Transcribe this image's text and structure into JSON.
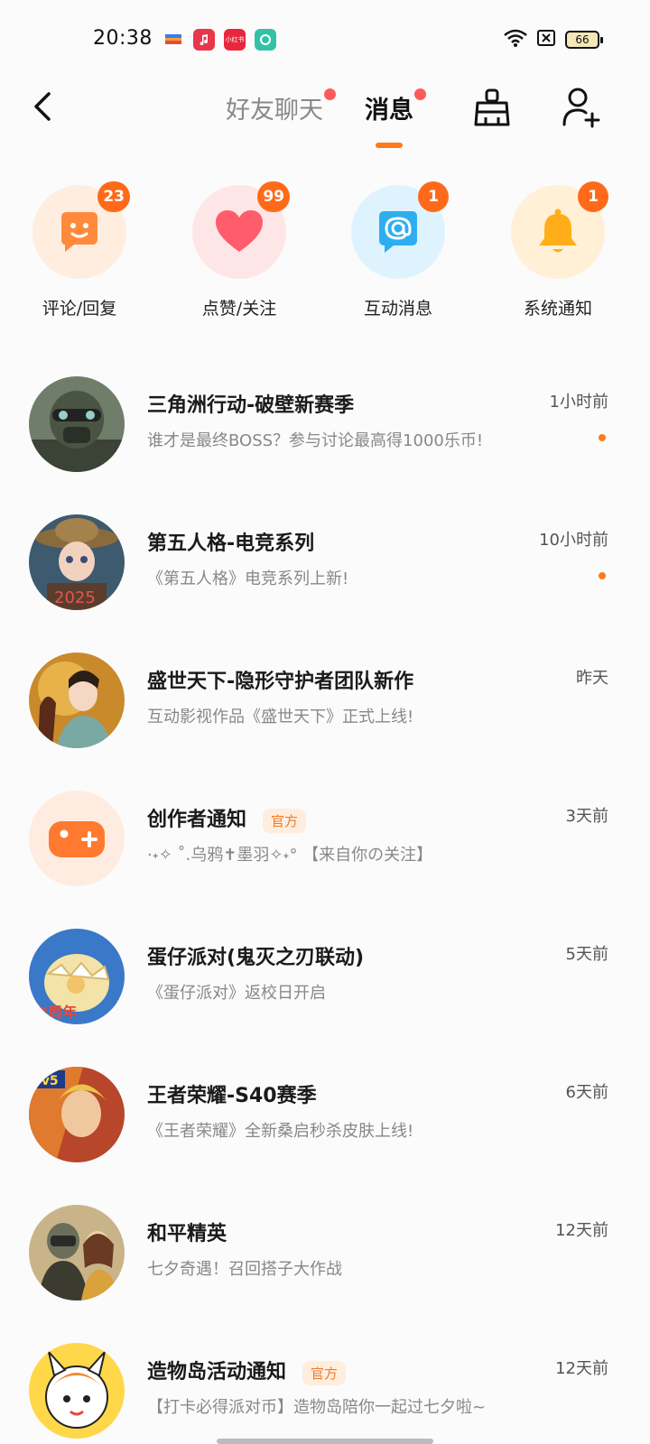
{
  "status_bar": {
    "time": "20:38",
    "apps": [
      "wallet-icon",
      "music-icon",
      "xiaohongshu-icon",
      "soul-icon"
    ],
    "xhs_label": "小红书",
    "battery": "66"
  },
  "nav": {
    "tabs": [
      {
        "label": "好友聊天",
        "active": false,
        "has_dot": true
      },
      {
        "label": "消息",
        "active": true,
        "has_dot": true
      }
    ],
    "accent_color": "#ff7a1a"
  },
  "categories": [
    {
      "label": "评论/回复",
      "badge": "23",
      "icon": "smile-chat-icon",
      "bg": "#ffeee0",
      "fg": "#ff8a3d"
    },
    {
      "label": "点赞/关注",
      "badge": "99",
      "icon": "heart-icon",
      "bg": "#ffe6e6",
      "fg": "#ff5c6c"
    },
    {
      "label": "互动消息",
      "badge": "1",
      "icon": "at-sign-icon",
      "bg": "#dff3ff",
      "fg": "#2eaef0"
    },
    {
      "label": "系统通知",
      "badge": "1",
      "icon": "bell-icon",
      "bg": "#fff0d6",
      "fg": "#ffae1a"
    }
  ],
  "messages": [
    {
      "title": "三角洲行动-破壁新赛季",
      "subtitle": "谁才是最终BOSS？参与讨论最高得1000乐币!",
      "time": "1小时前",
      "unread": true,
      "official": false
    },
    {
      "title": "第五人格-电竞系列",
      "subtitle": "《第五人格》电竞系列上新!",
      "time": "10小时前",
      "unread": true,
      "official": false
    },
    {
      "title": "盛世天下-隐形守护者团队新作",
      "subtitle": "互动影视作品《盛世天下》正式上线!",
      "time": "昨天",
      "unread": false,
      "official": false
    },
    {
      "title": "创作者通知",
      "subtitle": "·˖✧ ˚.乌鸦✝墨羽✧˖° 【来自你の关注】",
      "time": "3天前",
      "unread": false,
      "official": true
    },
    {
      "title": "蛋仔派对(鬼灭之刃联动)",
      "subtitle": "《蛋仔派对》返校日开启",
      "time": "5天前",
      "unread": false,
      "official": false
    },
    {
      "title": "王者荣耀-S40赛季",
      "subtitle": "《王者荣耀》全新桑启秒杀皮肤上线!",
      "time": "6天前",
      "unread": false,
      "official": false
    },
    {
      "title": "和平精英",
      "subtitle": "七夕奇遇！召回搭子大作战",
      "time": "12天前",
      "unread": false,
      "official": false
    },
    {
      "title": "造物岛活动通知",
      "subtitle": "【打卡必得派对币】造物岛陪你一起过七夕啦~",
      "time": "12天前",
      "unread": false,
      "official": true
    }
  ],
  "official_label": "官方"
}
